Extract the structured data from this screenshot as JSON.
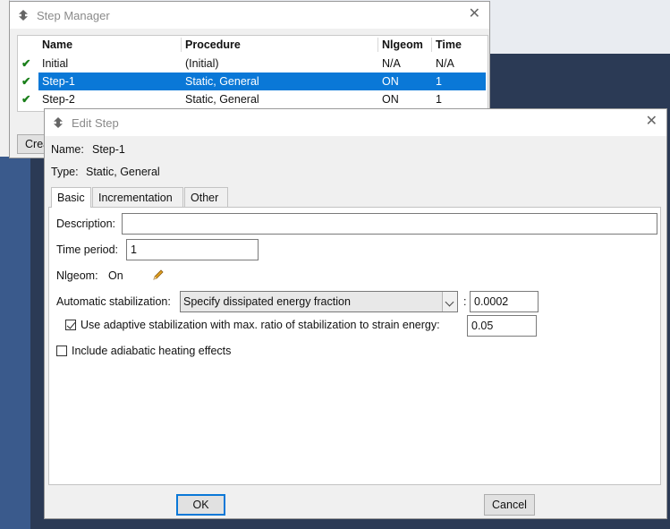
{
  "step_manager": {
    "title": "Step Manager",
    "close_glyph": "✕",
    "columns": [
      "Name",
      "Procedure",
      "Nlgeom",
      "Time"
    ],
    "rows": [
      {
        "check": "✔",
        "name": "Initial",
        "procedure": "(Initial)",
        "nlgeom": "N/A",
        "time": "N/A"
      },
      {
        "check": "✔",
        "name": "Step-1",
        "procedure": "Static, General",
        "nlgeom": "ON",
        "time": "1"
      },
      {
        "check": "✔",
        "name": "Step-2",
        "procedure": "Static, General",
        "nlgeom": "ON",
        "time": "1"
      }
    ],
    "selected_row": 1,
    "create_button_label": "Create..."
  },
  "edit_step": {
    "title": "Edit Step",
    "close_glyph": "✕",
    "name_label": "Name:",
    "name_value": "Step-1",
    "type_label": "Type:",
    "type_value": "Static, General",
    "tabs": [
      "Basic",
      "Incrementation",
      "Other"
    ],
    "active_tab": "Basic",
    "description_label": "Description:",
    "description_value": "",
    "time_period_label": "Time period:",
    "time_period_value": "1",
    "nlgeom_label": "Nlgeom:",
    "nlgeom_value": "On",
    "auto_stab_label": "Automatic stabilization:",
    "auto_stab_option": "Specify dissipated energy fraction",
    "colon": ":",
    "energy_fraction_value": "0.0002",
    "adaptive_checked": true,
    "adaptive_label": "Use adaptive stabilization with max. ratio of stabilization to strain energy:",
    "adaptive_ratio_value": "0.05",
    "adiabatic_checked": false,
    "adiabatic_label": "Include adiabatic heating effects",
    "ok_label": "OK",
    "cancel_label": "Cancel"
  },
  "icons": {
    "app": "abaqus-app-icon",
    "edit": "pencil-icon",
    "check": "green-check-icon"
  },
  "colors": {
    "selection": "#0a78d7",
    "check": "#1a7f1a",
    "pencil": "#e0a020"
  }
}
